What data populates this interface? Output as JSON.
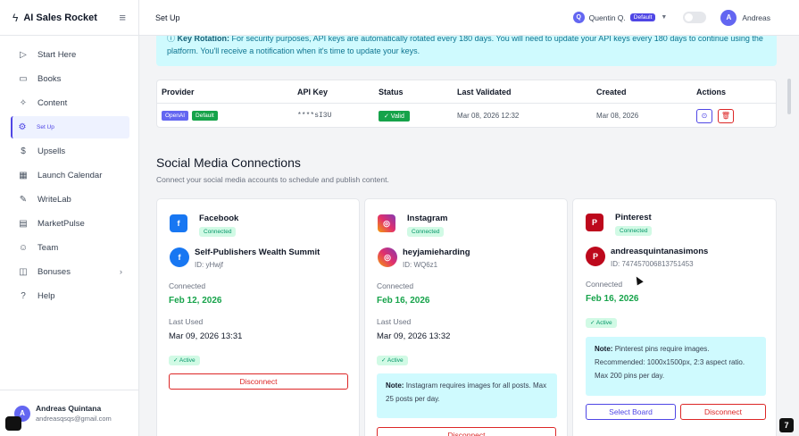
{
  "app": {
    "name": "AI Sales Rocket"
  },
  "sidebar": {
    "items": [
      {
        "label": "Start Here",
        "icon": "play-circle-icon"
      },
      {
        "label": "Books",
        "icon": "book-icon"
      },
      {
        "label": "Content",
        "icon": "sparkle-icon"
      },
      {
        "label": "Set Up",
        "icon": "gear-icon"
      },
      {
        "label": "Upsells",
        "icon": "dollar-icon"
      },
      {
        "label": "Launch Calendar",
        "icon": "calendar-icon"
      },
      {
        "label": "WriteLab",
        "icon": "edit-icon"
      },
      {
        "label": "MarketPulse",
        "icon": "chart-icon"
      },
      {
        "label": "Team",
        "icon": "users-icon"
      },
      {
        "label": "Bonuses",
        "icon": "gift-icon"
      },
      {
        "label": "Help",
        "icon": "help-icon"
      }
    ],
    "active": "Set Up",
    "user": {
      "initial": "A",
      "name": "Andreas Quintana",
      "email": "andreasqsqs@gmail.com"
    }
  },
  "header": {
    "page_title": "Set Up",
    "workspace": {
      "initial": "Q",
      "name": "Quentin Q.",
      "badge": "Default"
    },
    "user": {
      "initial": "A",
      "name": "Andreas"
    }
  },
  "key_rotation": {
    "title": "Key Rotation:",
    "text": "For security purposes, API keys are automatically rotated every 180 days. You will need to update your API keys every 180 days to continue using the platform. You'll receive a notification when it's time to update your keys."
  },
  "api_table": {
    "headers": [
      "Provider",
      "API Key",
      "Status",
      "Last Validated",
      "Created",
      "Actions"
    ],
    "rows": [
      {
        "provider": "OpenAI",
        "default": "Default",
        "key": "****sI3U",
        "status": "✓ Valid",
        "last_validated": "Mar 08, 2026 12:32",
        "created": "Mar 08, 2026"
      }
    ]
  },
  "social": {
    "title": "Social Media Connections",
    "subtitle": "Connect your social media accounts to schedule and publish content.",
    "cards": [
      {
        "platform": "Facebook",
        "status": "Connected",
        "account": "Self-Publishers Wealth Summit",
        "id": "ID: yHwjf",
        "connected_label": "Connected",
        "connected_date": "Feb 12, 2026",
        "last_used_label": "Last Used",
        "last_used": "Mar 09, 2026 13:31",
        "active": "✓ Active",
        "disconnect": "Disconnect"
      },
      {
        "platform": "Instagram",
        "status": "Connected",
        "account": "heyjamieharding",
        "id": "ID: WQ6z1",
        "connected_label": "Connected",
        "connected_date": "Feb 16, 2026",
        "last_used_label": "Last Used",
        "last_used": "Mar 09, 2026 13:32",
        "active": "✓ Active",
        "note_title": "Note:",
        "note": "Instagram requires images for all posts. Max 25 posts per day.",
        "disconnect": "Disconnect"
      },
      {
        "platform": "Pinterest",
        "status": "Connected",
        "account": "andreasquintanasimons",
        "id": "ID: 747457006813751453",
        "connected_label": "Connected",
        "connected_date": "Feb 16, 2026",
        "active": "✓ Active",
        "note_title": "Note:",
        "note": "Pinterest pins require images. Recommended: 1000x1500px, 2:3 aspect ratio. Max 200 pins per day.",
        "select_board": "Select Board",
        "disconnect": "Disconnect"
      }
    ]
  },
  "colors": {
    "accent": "#4f46e5",
    "success": "#16a34a",
    "danger": "#dc2626",
    "info_bg": "#cffafe"
  }
}
